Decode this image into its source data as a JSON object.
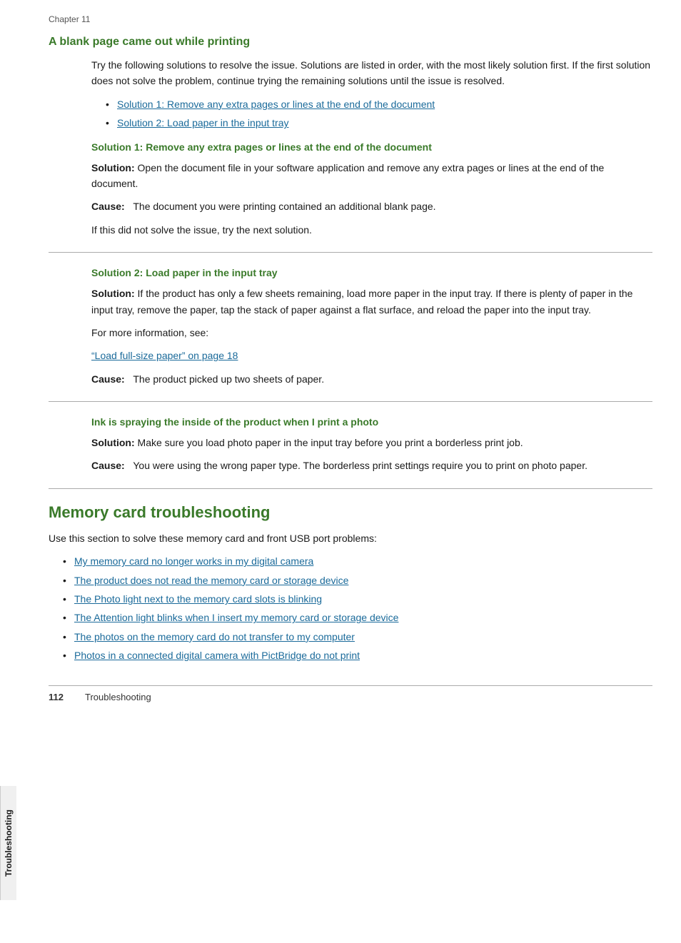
{
  "chapter": {
    "label": "Chapter 11"
  },
  "blank_page_section": {
    "heading": "A blank page came out while printing",
    "intro": "Try the following solutions to resolve the issue. Solutions are listed in order, with the most likely solution first. If the first solution does not solve the problem, continue trying the remaining solutions until the issue is resolved.",
    "links": [
      {
        "text": "Solution 1: Remove any extra pages or lines at the end of the document"
      },
      {
        "text": "Solution 2: Load paper in the input tray"
      }
    ]
  },
  "solution1": {
    "heading": "Solution 1: Remove any extra pages or lines at the end of the document",
    "solution_label": "Solution:",
    "solution_text": "Open the document file in your software application and remove any extra pages or lines at the end of the document.",
    "cause_label": "Cause:",
    "cause_text": "The document you were printing contained an additional blank page.",
    "next_solution_text": "If this did not solve the issue, try the next solution."
  },
  "solution2": {
    "heading": "Solution 2: Load paper in the input tray",
    "solution_label": "Solution:",
    "solution_text": "If the product has only a few sheets remaining, load more paper in the input tray. If there is plenty of paper in the input tray, remove the paper, tap the stack of paper against a flat surface, and reload the paper into the input tray.",
    "more_info_text": "For more information, see:",
    "link_text": "“Load full-size paper” on page 18",
    "cause_label": "Cause:",
    "cause_text": "The product picked up two sheets of paper."
  },
  "ink_spray_section": {
    "heading": "Ink is spraying the inside of the product when I print a photo",
    "solution_label": "Solution:",
    "solution_text": "Make sure you load photo paper in the input tray before you print a borderless print job.",
    "cause_label": "Cause:",
    "cause_text": "You were using the wrong paper type. The borderless print settings require you to print on photo paper."
  },
  "memory_card_section": {
    "heading": "Memory card troubleshooting",
    "intro": "Use this section to solve these memory card and front USB port problems:",
    "links": [
      {
        "text": "My memory card no longer works in my digital camera"
      },
      {
        "text": "The product does not read the memory card or storage device"
      },
      {
        "text": "The Photo light next to the memory card slots is blinking"
      },
      {
        "text": "The Attention light blinks when I insert my memory card or storage device"
      },
      {
        "text": "The photos on the memory card do not transfer to my computer"
      },
      {
        "text": "Photos in a connected digital camera with PictBridge do not print"
      }
    ]
  },
  "footer": {
    "page_number": "112",
    "section_label": "Troubleshooting"
  },
  "side_tab": {
    "label": "Troubleshooting"
  }
}
